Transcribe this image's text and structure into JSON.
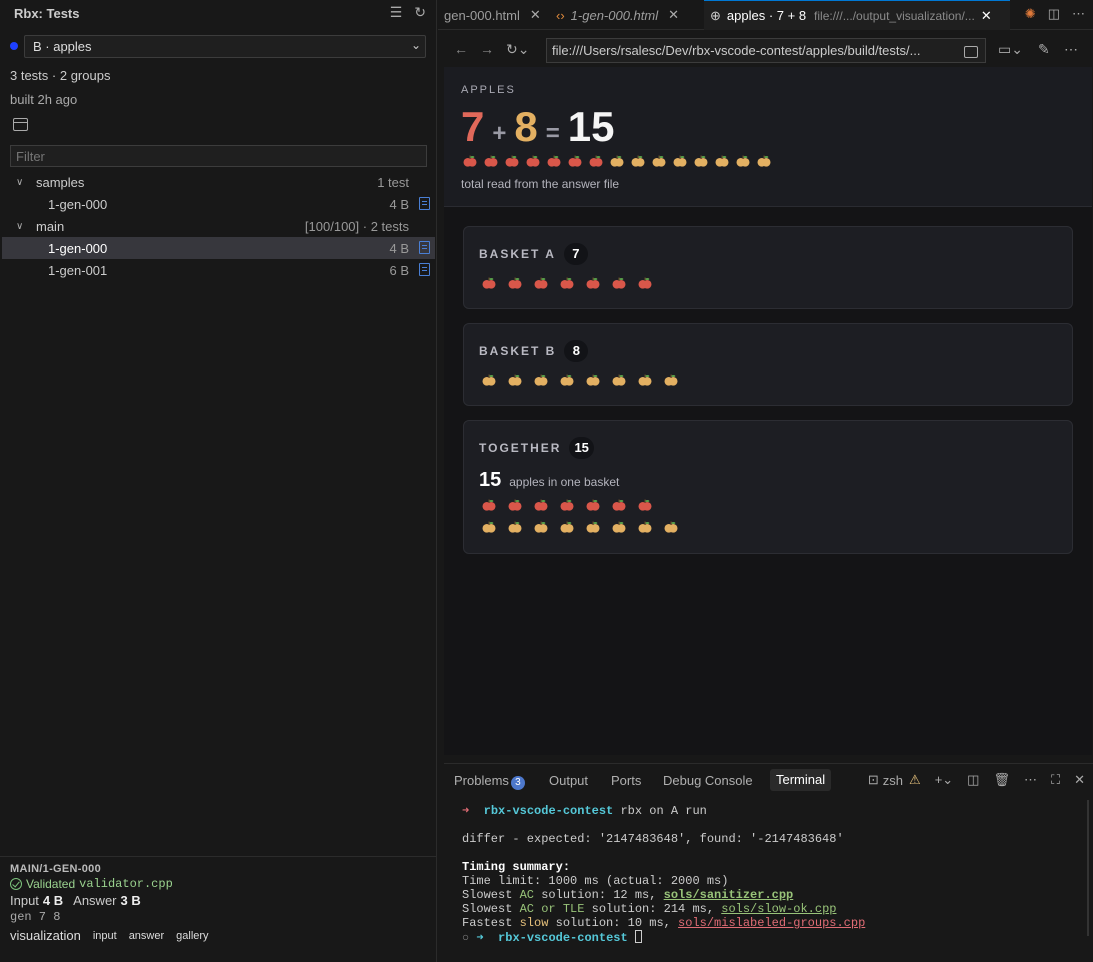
{
  "sidebar": {
    "title": "Rbx: Tests",
    "selector": "B · apples",
    "stats": "3 tests · 2 groups",
    "built": "built 2h ago",
    "filter_placeholder": "Filter",
    "groups": [
      {
        "name": "samples",
        "right": "1 test",
        "items": [
          {
            "name": "1-gen-000",
            "size": "4 B"
          }
        ]
      },
      {
        "name": "main",
        "right": "[100/100] · 2 tests",
        "items": [
          {
            "name": "1-gen-000",
            "size": "4 B"
          },
          {
            "name": "1-gen-001",
            "size": "6 B"
          }
        ]
      }
    ],
    "details": {
      "title": "MAIN/1-GEN-000",
      "validated": "Validated",
      "validator": "validator.cpp",
      "input_label": "Input",
      "input_size": "4 B",
      "answer_label": "Answer",
      "answer_size": "3 B",
      "gen": "gen 7 8",
      "visualization": "visualization",
      "links": [
        "input",
        "answer",
        "gallery"
      ]
    }
  },
  "tabs": [
    {
      "label": "gen-000.html"
    },
    {
      "label": "1-gen-000.html"
    },
    {
      "label": "apples · 7 + 8",
      "sub": "file:///.../output_visualization/..."
    }
  ],
  "browser": {
    "url": "file:///Users/rsalesc/Dev/rbx-vscode-contest/apples/build/tests/..."
  },
  "viz": {
    "label": "APPLES",
    "a": "7",
    "plus": "+",
    "b": "8",
    "equals": "=",
    "sum": "15",
    "caption": "total read from the answer file",
    "cards": [
      {
        "title": "BASKET A",
        "count": "7"
      },
      {
        "title": "BASKET B",
        "count": "8"
      },
      {
        "title": "TOGETHER",
        "count": "15",
        "big": "15",
        "big_caption": "apples in one basket"
      }
    ],
    "colors": {
      "red_apple": "#d9574a",
      "yellow_apple": "#e3b062"
    }
  },
  "panel": {
    "tabs": [
      "Problems",
      "Output",
      "Ports",
      "Debug Console",
      "Terminal"
    ],
    "problems_count": "3",
    "shell": "zsh",
    "terminal": {
      "prompt_dir": "rbx-vscode-contest",
      "cmd": "rbx on A run",
      "differ": "differ - expected: '2147483648', found: '-2147483648'",
      "summary_title": "Timing summary:",
      "time_limit": "Time limit: 1000 ms (actual: 2000 ms)",
      "slowest_ac_pre": "Slowest ",
      "ac": "AC",
      "slowest_ac_mid": " solution: 12 ms, ",
      "slowest_ac_file": "sols/sanitizer.cpp",
      "slowest_tle_pre": "Slowest ",
      "ac_or_tle": "AC or TLE",
      "slowest_tle_mid": " solution: 214 ms, ",
      "slowest_tle_file": "sols/slow-ok.cpp",
      "fastest_pre": "Fastest ",
      "slow": "slow",
      "fastest_mid": " solution: 10 ms, ",
      "fastest_file": "sols/mislabeled-groups.cpp",
      "final_prompt": "rbx-vscode-contest"
    }
  }
}
